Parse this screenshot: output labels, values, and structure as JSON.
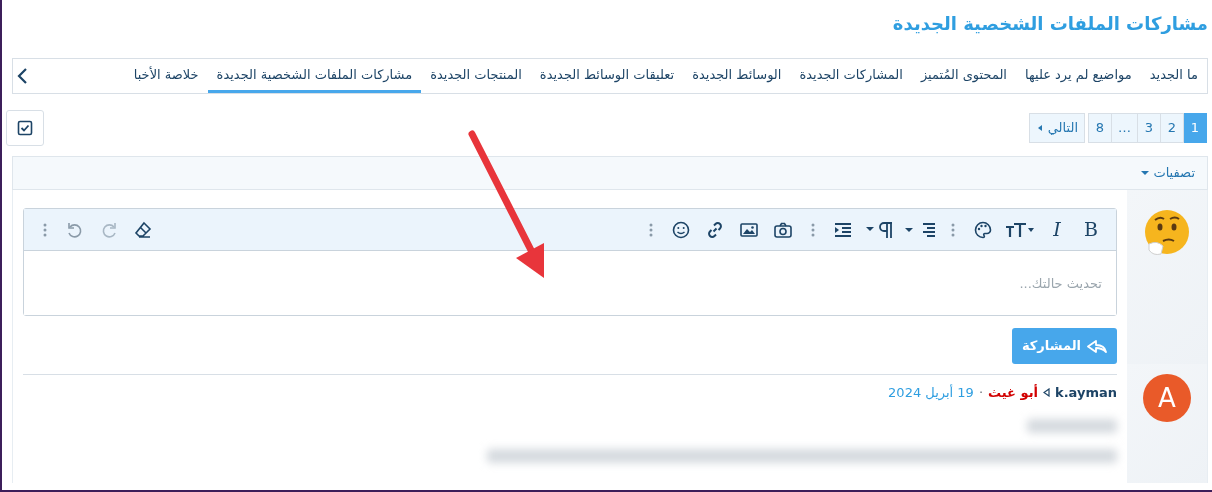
{
  "page_title": "مشاركات الملفات الشخصية الجديدة",
  "tabs": [
    {
      "label": "ما الجديد",
      "selected": false
    },
    {
      "label": "مواضيع لم يرد عليها",
      "selected": false
    },
    {
      "label": "المحتوى المُتميز",
      "selected": false
    },
    {
      "label": "المشاركات الجديدة",
      "selected": false
    },
    {
      "label": "الوسائط الجديدة",
      "selected": false
    },
    {
      "label": "تعليقات الوسائط الجديدة",
      "selected": false
    },
    {
      "label": "المنتجات الجديدة",
      "selected": false
    },
    {
      "label": "مشاركات الملفات الشخصية الجديدة",
      "selected": true
    },
    {
      "label": "خلاصة الأخبا",
      "selected": false
    }
  ],
  "pagination": {
    "pages": [
      {
        "label": "1",
        "selected": true
      },
      {
        "label": "2",
        "selected": false
      },
      {
        "label": "3",
        "selected": false
      },
      {
        "label": "…",
        "selected": false
      },
      {
        "label": "8",
        "selected": false
      }
    ],
    "next": "التالي"
  },
  "filters": "تصفيات",
  "editor": {
    "toolbar": [
      {
        "kind": "bold",
        "label": "B"
      },
      {
        "kind": "italic",
        "label": "I"
      },
      {
        "kind": "textsize"
      },
      {
        "kind": "palette"
      },
      {
        "kind": "more"
      },
      {
        "kind": "align"
      },
      {
        "kind": "paragraph"
      },
      {
        "kind": "indent"
      },
      {
        "kind": "more"
      },
      {
        "kind": "camera"
      },
      {
        "kind": "image"
      },
      {
        "kind": "link"
      },
      {
        "kind": "smiley"
      },
      {
        "kind": "more"
      },
      {
        "kind": "spacer"
      },
      {
        "kind": "eraser"
      },
      {
        "kind": "redo"
      },
      {
        "kind": "undo"
      },
      {
        "kind": "more"
      }
    ],
    "placeholder": "تحديث حالتك...",
    "submit": "المشاركة"
  },
  "post": {
    "avatar_letter": "A",
    "author": "k.ayman",
    "recipient": "أبو غيث",
    "separator": "·",
    "date": "19 أبريل 2024"
  }
}
